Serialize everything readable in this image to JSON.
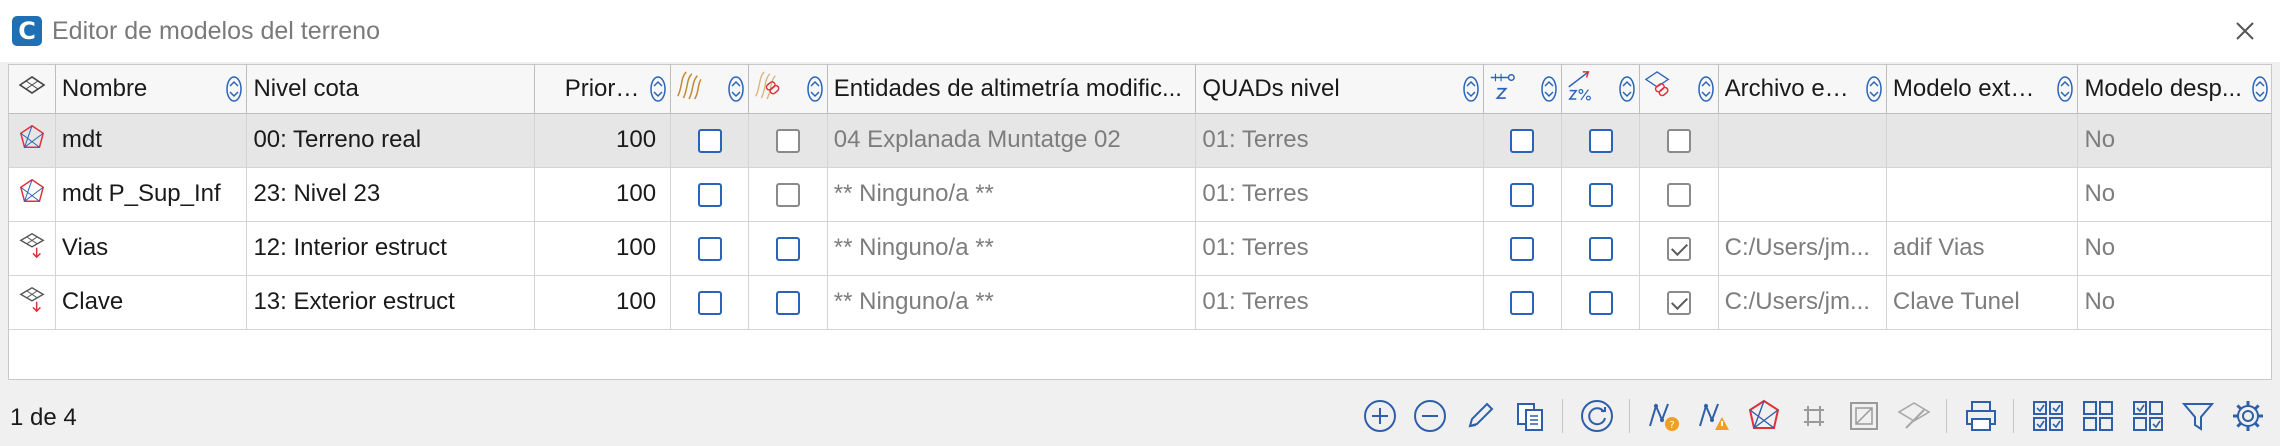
{
  "window": {
    "title": "Editor de modelos del terreno",
    "app_icon_letter": "C"
  },
  "columns": {
    "nombre": "Nombre",
    "nivel_cota": "Nivel cota",
    "prioridad": "Prioridad",
    "entidades": "Entidades de altimetría modific...",
    "quads": "QUADs nivel",
    "archivo": "Archivo ext...",
    "modelo_ext": "Modelo exter...",
    "modelo_desp": "Modelo desp..."
  },
  "rows": [
    {
      "icon": "tin-surface-icon",
      "nombre": "mdt",
      "nivel": "00: Terreno real",
      "prioridad": "100",
      "c1": false,
      "c2": false,
      "entidades": "04 Explanada Muntatge 02",
      "quads": "01: Terres",
      "c3": false,
      "c4": false,
      "c5": false,
      "archivo": "",
      "modelo_ext": "",
      "modelo_desp": "No",
      "selected": true
    },
    {
      "icon": "tin-surface-icon",
      "nombre": "mdt P_Sup_Inf",
      "nivel": "23: Nivel 23",
      "prioridad": "100",
      "c1": false,
      "c2": false,
      "entidades": "** Ninguno/a **",
      "quads": "01: Terres",
      "c3": false,
      "c4": false,
      "c5": false,
      "archivo": "",
      "modelo_ext": "",
      "modelo_desp": "No",
      "selected": false
    },
    {
      "icon": "external-model-icon",
      "nombre": "Vias",
      "nivel": "12: Interior estruct",
      "prioridad": "100",
      "c1": false,
      "c2": false,
      "entidades": "** Ninguno/a **",
      "quads": "01: Terres",
      "c3": false,
      "c4": false,
      "c5": true,
      "archivo": "C:/Users/jm...",
      "modelo_ext": "adif Vias",
      "modelo_desp": "No",
      "selected": false
    },
    {
      "icon": "external-model-icon",
      "nombre": "Clave",
      "nivel": "13: Exterior estruct",
      "prioridad": "100",
      "c1": false,
      "c2": false,
      "entidades": "** Ninguno/a **",
      "quads": "01: Terres",
      "c3": false,
      "c4": false,
      "c5": true,
      "archivo": "C:/Users/jm...",
      "modelo_ext": "Clave Tunel",
      "modelo_desp": "No",
      "selected": false
    }
  ],
  "status": {
    "record_position": "1 de 4"
  },
  "colors": {
    "checkbox_blue": "#2a64b8",
    "accent_red": "#e0303a",
    "tool_blue": "#2e5fa8"
  }
}
